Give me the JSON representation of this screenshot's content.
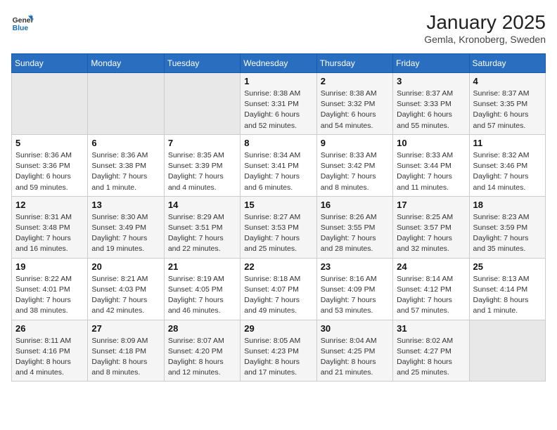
{
  "logo": {
    "line1": "General",
    "line2": "Blue"
  },
  "title": "January 2025",
  "location": "Gemla, Kronoberg, Sweden",
  "weekdays": [
    "Sunday",
    "Monday",
    "Tuesday",
    "Wednesday",
    "Thursday",
    "Friday",
    "Saturday"
  ],
  "weeks": [
    [
      {
        "day": "",
        "sunrise": "",
        "sunset": "",
        "daylight": ""
      },
      {
        "day": "",
        "sunrise": "",
        "sunset": "",
        "daylight": ""
      },
      {
        "day": "",
        "sunrise": "",
        "sunset": "",
        "daylight": ""
      },
      {
        "day": "1",
        "sunrise": "Sunrise: 8:38 AM",
        "sunset": "Sunset: 3:31 PM",
        "daylight": "Daylight: 6 hours and 52 minutes."
      },
      {
        "day": "2",
        "sunrise": "Sunrise: 8:38 AM",
        "sunset": "Sunset: 3:32 PM",
        "daylight": "Daylight: 6 hours and 54 minutes."
      },
      {
        "day": "3",
        "sunrise": "Sunrise: 8:37 AM",
        "sunset": "Sunset: 3:33 PM",
        "daylight": "Daylight: 6 hours and 55 minutes."
      },
      {
        "day": "4",
        "sunrise": "Sunrise: 8:37 AM",
        "sunset": "Sunset: 3:35 PM",
        "daylight": "Daylight: 6 hours and 57 minutes."
      }
    ],
    [
      {
        "day": "5",
        "sunrise": "Sunrise: 8:36 AM",
        "sunset": "Sunset: 3:36 PM",
        "daylight": "Daylight: 6 hours and 59 minutes."
      },
      {
        "day": "6",
        "sunrise": "Sunrise: 8:36 AM",
        "sunset": "Sunset: 3:38 PM",
        "daylight": "Daylight: 7 hours and 1 minute."
      },
      {
        "day": "7",
        "sunrise": "Sunrise: 8:35 AM",
        "sunset": "Sunset: 3:39 PM",
        "daylight": "Daylight: 7 hours and 4 minutes."
      },
      {
        "day": "8",
        "sunrise": "Sunrise: 8:34 AM",
        "sunset": "Sunset: 3:41 PM",
        "daylight": "Daylight: 7 hours and 6 minutes."
      },
      {
        "day": "9",
        "sunrise": "Sunrise: 8:33 AM",
        "sunset": "Sunset: 3:42 PM",
        "daylight": "Daylight: 7 hours and 8 minutes."
      },
      {
        "day": "10",
        "sunrise": "Sunrise: 8:33 AM",
        "sunset": "Sunset: 3:44 PM",
        "daylight": "Daylight: 7 hours and 11 minutes."
      },
      {
        "day": "11",
        "sunrise": "Sunrise: 8:32 AM",
        "sunset": "Sunset: 3:46 PM",
        "daylight": "Daylight: 7 hours and 14 minutes."
      }
    ],
    [
      {
        "day": "12",
        "sunrise": "Sunrise: 8:31 AM",
        "sunset": "Sunset: 3:48 PM",
        "daylight": "Daylight: 7 hours and 16 minutes."
      },
      {
        "day": "13",
        "sunrise": "Sunrise: 8:30 AM",
        "sunset": "Sunset: 3:49 PM",
        "daylight": "Daylight: 7 hours and 19 minutes."
      },
      {
        "day": "14",
        "sunrise": "Sunrise: 8:29 AM",
        "sunset": "Sunset: 3:51 PM",
        "daylight": "Daylight: 7 hours and 22 minutes."
      },
      {
        "day": "15",
        "sunrise": "Sunrise: 8:27 AM",
        "sunset": "Sunset: 3:53 PM",
        "daylight": "Daylight: 7 hours and 25 minutes."
      },
      {
        "day": "16",
        "sunrise": "Sunrise: 8:26 AM",
        "sunset": "Sunset: 3:55 PM",
        "daylight": "Daylight: 7 hours and 28 minutes."
      },
      {
        "day": "17",
        "sunrise": "Sunrise: 8:25 AM",
        "sunset": "Sunset: 3:57 PM",
        "daylight": "Daylight: 7 hours and 32 minutes."
      },
      {
        "day": "18",
        "sunrise": "Sunrise: 8:23 AM",
        "sunset": "Sunset: 3:59 PM",
        "daylight": "Daylight: 7 hours and 35 minutes."
      }
    ],
    [
      {
        "day": "19",
        "sunrise": "Sunrise: 8:22 AM",
        "sunset": "Sunset: 4:01 PM",
        "daylight": "Daylight: 7 hours and 38 minutes."
      },
      {
        "day": "20",
        "sunrise": "Sunrise: 8:21 AM",
        "sunset": "Sunset: 4:03 PM",
        "daylight": "Daylight: 7 hours and 42 minutes."
      },
      {
        "day": "21",
        "sunrise": "Sunrise: 8:19 AM",
        "sunset": "Sunset: 4:05 PM",
        "daylight": "Daylight: 7 hours and 46 minutes."
      },
      {
        "day": "22",
        "sunrise": "Sunrise: 8:18 AM",
        "sunset": "Sunset: 4:07 PM",
        "daylight": "Daylight: 7 hours and 49 minutes."
      },
      {
        "day": "23",
        "sunrise": "Sunrise: 8:16 AM",
        "sunset": "Sunset: 4:09 PM",
        "daylight": "Daylight: 7 hours and 53 minutes."
      },
      {
        "day": "24",
        "sunrise": "Sunrise: 8:14 AM",
        "sunset": "Sunset: 4:12 PM",
        "daylight": "Daylight: 7 hours and 57 minutes."
      },
      {
        "day": "25",
        "sunrise": "Sunrise: 8:13 AM",
        "sunset": "Sunset: 4:14 PM",
        "daylight": "Daylight: 8 hours and 1 minute."
      }
    ],
    [
      {
        "day": "26",
        "sunrise": "Sunrise: 8:11 AM",
        "sunset": "Sunset: 4:16 PM",
        "daylight": "Daylight: 8 hours and 4 minutes."
      },
      {
        "day": "27",
        "sunrise": "Sunrise: 8:09 AM",
        "sunset": "Sunset: 4:18 PM",
        "daylight": "Daylight: 8 hours and 8 minutes."
      },
      {
        "day": "28",
        "sunrise": "Sunrise: 8:07 AM",
        "sunset": "Sunset: 4:20 PM",
        "daylight": "Daylight: 8 hours and 12 minutes."
      },
      {
        "day": "29",
        "sunrise": "Sunrise: 8:05 AM",
        "sunset": "Sunset: 4:23 PM",
        "daylight": "Daylight: 8 hours and 17 minutes."
      },
      {
        "day": "30",
        "sunrise": "Sunrise: 8:04 AM",
        "sunset": "Sunset: 4:25 PM",
        "daylight": "Daylight: 8 hours and 21 minutes."
      },
      {
        "day": "31",
        "sunrise": "Sunrise: 8:02 AM",
        "sunset": "Sunset: 4:27 PM",
        "daylight": "Daylight: 8 hours and 25 minutes."
      },
      {
        "day": "",
        "sunrise": "",
        "sunset": "",
        "daylight": ""
      }
    ]
  ]
}
